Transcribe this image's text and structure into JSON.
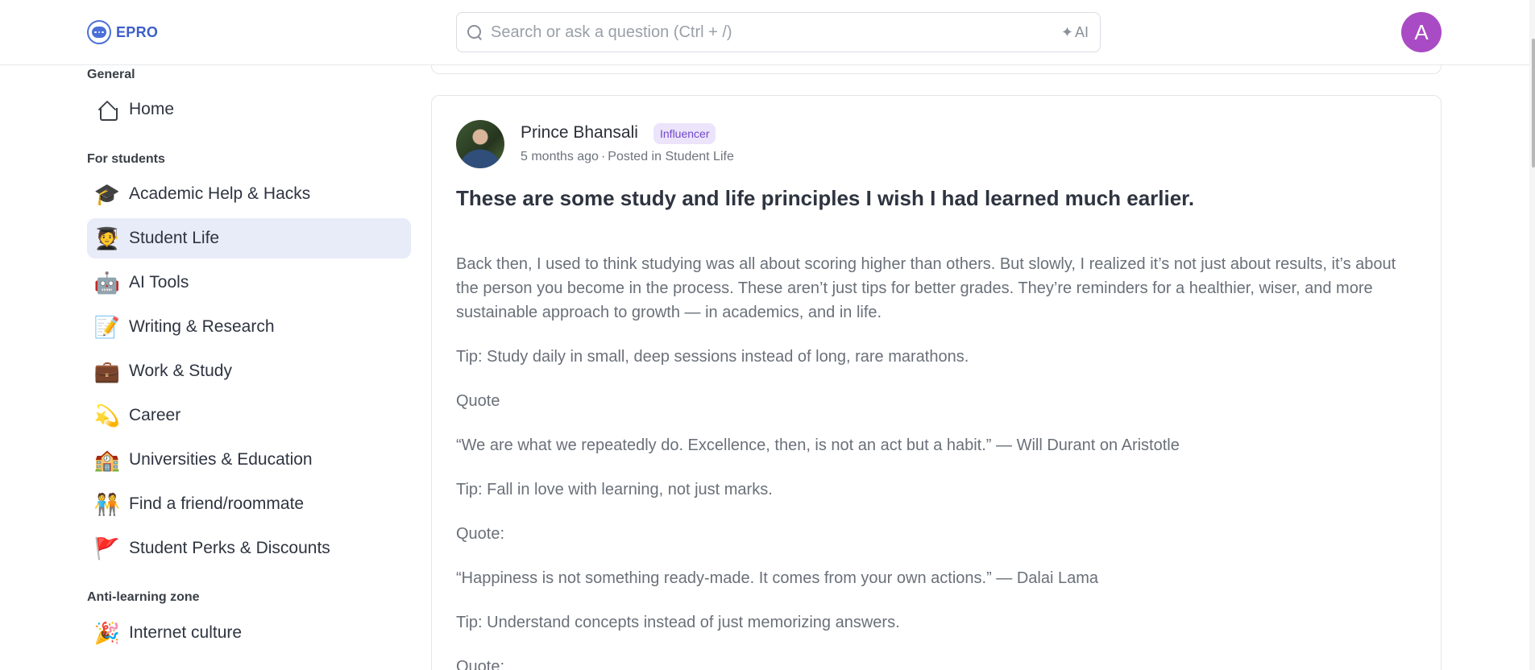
{
  "header": {
    "logo_text": "EPRO",
    "search_placeholder": "Search or ask a question (Ctrl + /)",
    "ai_label": "AI",
    "avatar_initial": "A",
    "avatar_color": "#a94bc4"
  },
  "sidebar": {
    "sections": [
      {
        "title": "General"
      },
      {
        "title": "For students"
      },
      {
        "title": "Anti-learning zone"
      }
    ],
    "items": [
      {
        "label": "Home",
        "icon": "home-icon",
        "glyph": ""
      },
      {
        "label": "Academic Help & Hacks",
        "icon": "graduation-cap-icon",
        "glyph": "🎓"
      },
      {
        "label": "Student Life",
        "icon": "student-icon",
        "glyph": "🧑‍🎓",
        "active": true
      },
      {
        "label": "AI Tools",
        "icon": "robot-icon",
        "glyph": "🤖"
      },
      {
        "label": "Writing & Research",
        "icon": "memo-icon",
        "glyph": "📝"
      },
      {
        "label": "Work & Study",
        "icon": "briefcase-icon",
        "glyph": "💼"
      },
      {
        "label": "Career",
        "icon": "dizzy-star-icon",
        "glyph": "💫"
      },
      {
        "label": "Universities & Education",
        "icon": "school-icon",
        "glyph": "🏫"
      },
      {
        "label": "Find a friend/roommate",
        "icon": "people-holding-hands-icon",
        "glyph": "🧑‍🤝‍🧑"
      },
      {
        "label": "Student Perks & Discounts",
        "icon": "red-flag-icon",
        "glyph": "🚩"
      },
      {
        "label": "Internet culture",
        "icon": "party-popper-icon",
        "glyph": "🎉"
      }
    ],
    "active_bg": "#e8ebf8"
  },
  "post": {
    "author": "Prince Bhansali",
    "badge": "Influencer",
    "time": "5 months ago",
    "posted_in_prefix": "Posted in",
    "community": "Student Life",
    "title": "These are some study and life principles I wish I had learned much earlier.",
    "paragraphs": [
      "Back then, I used to think studying was all about scoring higher than others. But slowly, I realized it’s not just about results, it’s about the person you become in the process. These aren’t just tips for better grades. They’re reminders for a healthier, wiser, and more sustainable approach to growth — in academics, and in life.",
      "Tip: Study daily in small, deep sessions instead of long, rare marathons.",
      "Quote",
      "“We are what we repeatedly do. Excellence, then, is not an act but a habit.” — Will Durant on Aristotle",
      "Tip: Fall in love with learning, not just marks.",
      "Quote:",
      "“Happiness is not something ready-made. It comes from your own actions.” — Dalai Lama",
      "Tip: Understand concepts instead of just memorizing answers.",
      "Quote:"
    ]
  }
}
